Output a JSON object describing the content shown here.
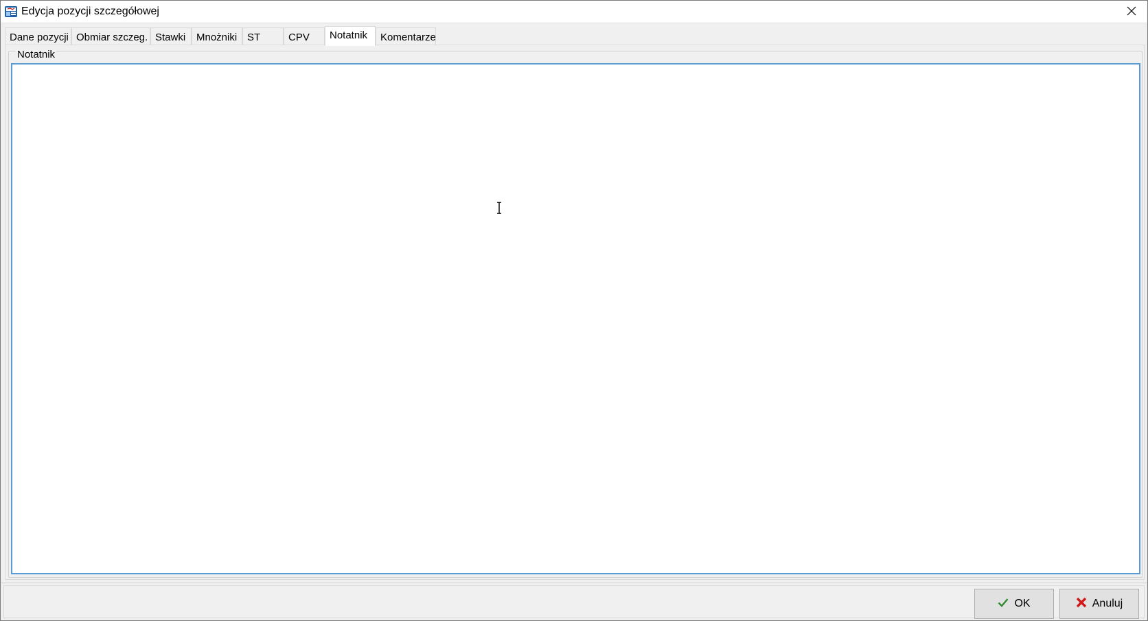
{
  "window": {
    "title": "Edycja pozycji szczegółowej"
  },
  "tabs": [
    {
      "label": "Dane pozycji",
      "active": false
    },
    {
      "label": "Obmiar szczeg.",
      "active": false
    },
    {
      "label": "Stawki",
      "active": false
    },
    {
      "label": "Mnożniki",
      "active": false
    },
    {
      "label": "ST",
      "active": false
    },
    {
      "label": "CPV",
      "active": false
    },
    {
      "label": "Notatnik",
      "active": true
    },
    {
      "label": "Komentarze",
      "active": false
    }
  ],
  "panel": {
    "group_label": "Notatnik",
    "notes_value": ""
  },
  "buttons": {
    "ok_label": "OK",
    "cancel_label": "Anuluj"
  },
  "icons": {
    "app": "app-icon",
    "close": "close-icon",
    "ok": "checkmark-icon",
    "cancel": "x-icon",
    "cursor": "ibeam-cursor-icon"
  },
  "colors": {
    "focus_border": "#5a9bd5",
    "ok_check": "#2e8b2e",
    "cancel_x": "#d11a1a"
  }
}
